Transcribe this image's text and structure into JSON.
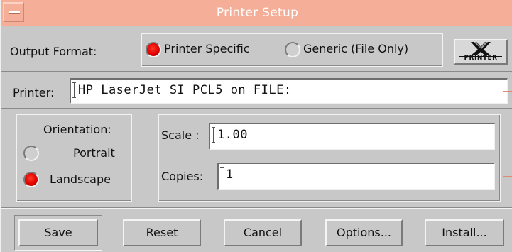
{
  "window": {
    "title": "Printer Setup",
    "accent_color": "#f5ae97",
    "menu_icon": "window-menu-icon"
  },
  "output_format": {
    "label": "Output Format:",
    "options": [
      {
        "label": "Printer Specific",
        "selected": true
      },
      {
        "label": "Generic (File Only)",
        "selected": false
      }
    ],
    "logo_text": "PRINTER",
    "logo_icon": "x-printer-logo-icon"
  },
  "printer": {
    "label": "Printer:",
    "value": "HP LaserJet SI PCL5 on FILE:"
  },
  "orientation": {
    "label": "Orientation:",
    "options": [
      {
        "label": "Portrait",
        "selected": false
      },
      {
        "label": "Landscape",
        "selected": true
      }
    ]
  },
  "scale": {
    "label": "Scale :",
    "value": "1.00"
  },
  "copies": {
    "label": "Copies:",
    "value": "1"
  },
  "buttons": {
    "save": "Save",
    "reset": "Reset",
    "cancel": "Cancel",
    "options": "Options...",
    "install": "Install..."
  },
  "colors": {
    "radio_on": "#e00000",
    "background": "#c8c8c8"
  }
}
